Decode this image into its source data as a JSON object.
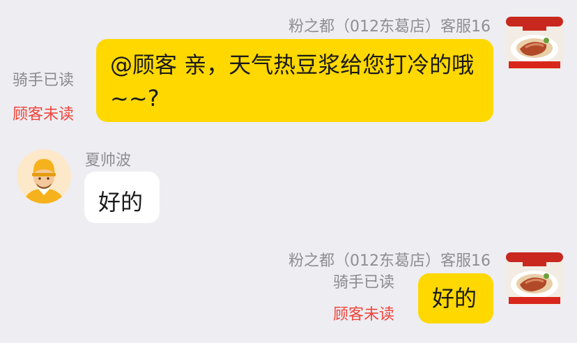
{
  "messages": [
    {
      "sender": "粉之都（012东葛店）客服16",
      "text": "@顾客 亲，天气热豆浆给您打冷的哦~~?",
      "rider_status": "骑手已读",
      "customer_status": "顾客未读",
      "avatar_icon": "store-food-avatar-icon"
    },
    {
      "sender": "夏帅波",
      "text": "好的",
      "avatar_icon": "rider-helmet-avatar-icon"
    },
    {
      "sender": "粉之都（012东葛店）客服16",
      "text": "好的",
      "rider_status": "骑手已读",
      "customer_status": "顾客未读",
      "avatar_icon": "store-food-avatar-icon"
    }
  ],
  "colors": {
    "background": "#ededf2",
    "agent_bubble": "#ffd800",
    "user_bubble": "#ffffff",
    "unread": "#f0453a",
    "meta_text": "#8e8e93"
  }
}
